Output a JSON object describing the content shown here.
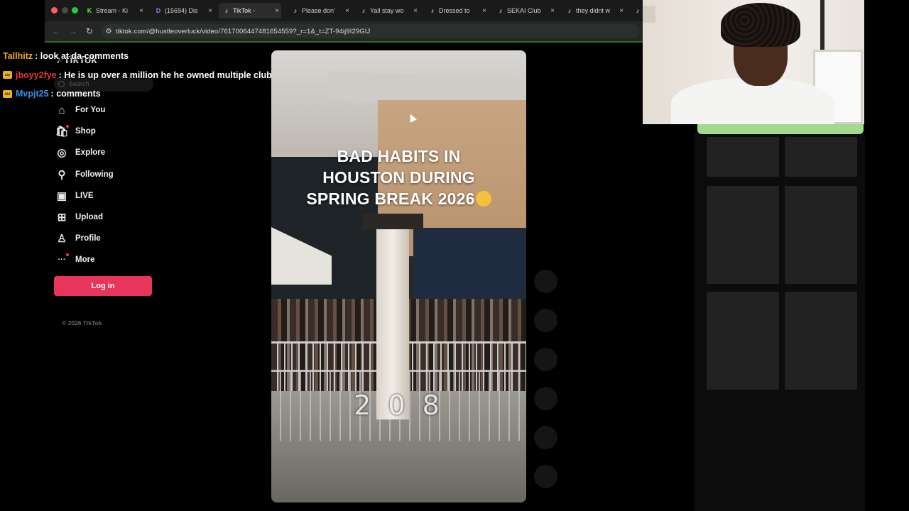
{
  "browser": {
    "tabs": [
      {
        "title": "Stream - Ki",
        "favicon": "K",
        "color": "#53fc18",
        "active": false
      },
      {
        "title": "(15694) Dis",
        "favicon": "D",
        "color": "#8a7cff",
        "active": false
      },
      {
        "title": "TikTok -",
        "favicon": "♪",
        "color": "#ffffff",
        "active": true
      },
      {
        "title": "Please don'",
        "favicon": "♪",
        "color": "#ffffff",
        "active": false
      },
      {
        "title": "Yall stay wo",
        "favicon": "♪",
        "color": "#ffffff",
        "active": false
      },
      {
        "title": "Dressed to",
        "favicon": "♪",
        "color": "#ffffff",
        "active": false
      },
      {
        "title": "SEKAI Club",
        "favicon": "♪",
        "color": "#ffffff",
        "active": false
      },
      {
        "title": "they didnt w",
        "favicon": "♪",
        "color": "#ffffff",
        "active": false
      },
      {
        "title": "",
        "favicon": "♪",
        "color": "#ffffff",
        "active": false
      }
    ],
    "url": "tiktok.com/@hustleoverluck/video/7617006447481654559?_r=1&_t=ZT-94ij9I29GIJ",
    "back_icon": "arrow-left-icon",
    "forward_icon": "arrow-right-icon",
    "reload_icon": "reload-icon"
  },
  "chat": [
    {
      "user": "Tallhitz",
      "color": "#f0a830",
      "badge": false,
      "message": "look at da comments"
    },
    {
      "user": "jboyy2fye",
      "color": "#e0383a",
      "badge": true,
      "message": "He is up over a million he he owned multiple clubs out there"
    },
    {
      "user": "Mvpjt25",
      "color": "#3a8ce6",
      "badge": true,
      "message": "comments"
    }
  ],
  "chat_separator": ":",
  "tiktok": {
    "logo": "TikTok",
    "search_placeholder": "Search",
    "nav": [
      {
        "label": "For You",
        "icon": "home-icon",
        "dot": false
      },
      {
        "label": "Shop",
        "icon": "shopping-bag-icon",
        "dot": true
      },
      {
        "label": "Explore",
        "icon": "compass-icon",
        "dot": false
      },
      {
        "label": "Following",
        "icon": "user-follow-icon",
        "dot": false
      },
      {
        "label": "LIVE",
        "icon": "live-tv-icon",
        "dot": false
      },
      {
        "label": "Upload",
        "icon": "plus-square-icon",
        "dot": false
      },
      {
        "label": "Profile",
        "icon": "person-icon",
        "dot": false
      },
      {
        "label": "More",
        "icon": "more-icon",
        "dot": true
      }
    ],
    "login_label": "Log in",
    "copyright": "© 2026 TikTok",
    "accent": "#e8355a"
  },
  "video": {
    "caption_lines": [
      "BAD HABITS IN",
      "HOUSTON DURING",
      "SPRING BREAK 2026"
    ],
    "emoji": "flushed-face-emoji",
    "timer": "2 0 8"
  },
  "action_buttons": 6,
  "webcam_accent": "#a3d98d"
}
